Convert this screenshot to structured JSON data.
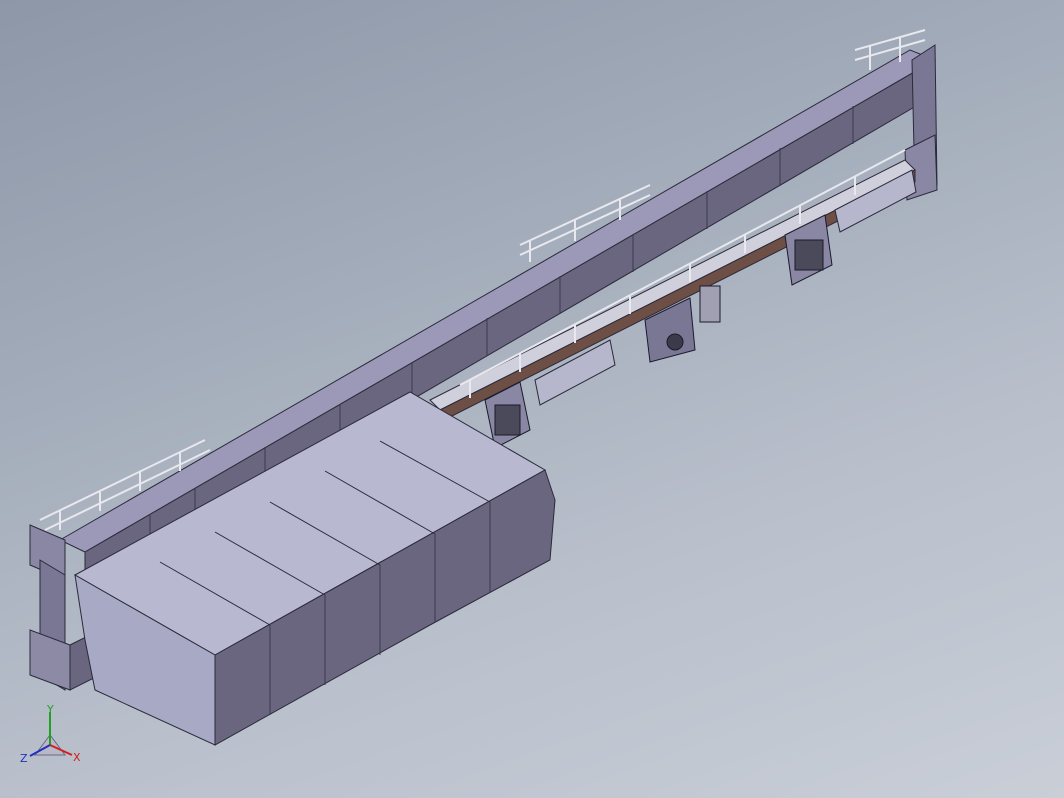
{
  "viewport": {
    "background_top": "#8d97a8",
    "background_bottom": "#c9ced7"
  },
  "model": {
    "body_color": "#6a6680",
    "body_light": "#9c99b8",
    "body_top": "#b8b9d0",
    "rail_color": "#6e4f45",
    "frame_color": "#d8d8e0"
  },
  "triad": {
    "x_label": "X",
    "y_label": "Y",
    "z_label": "Z",
    "x_color": "#d02020",
    "y_color": "#20a020",
    "z_color": "#2030c0"
  }
}
